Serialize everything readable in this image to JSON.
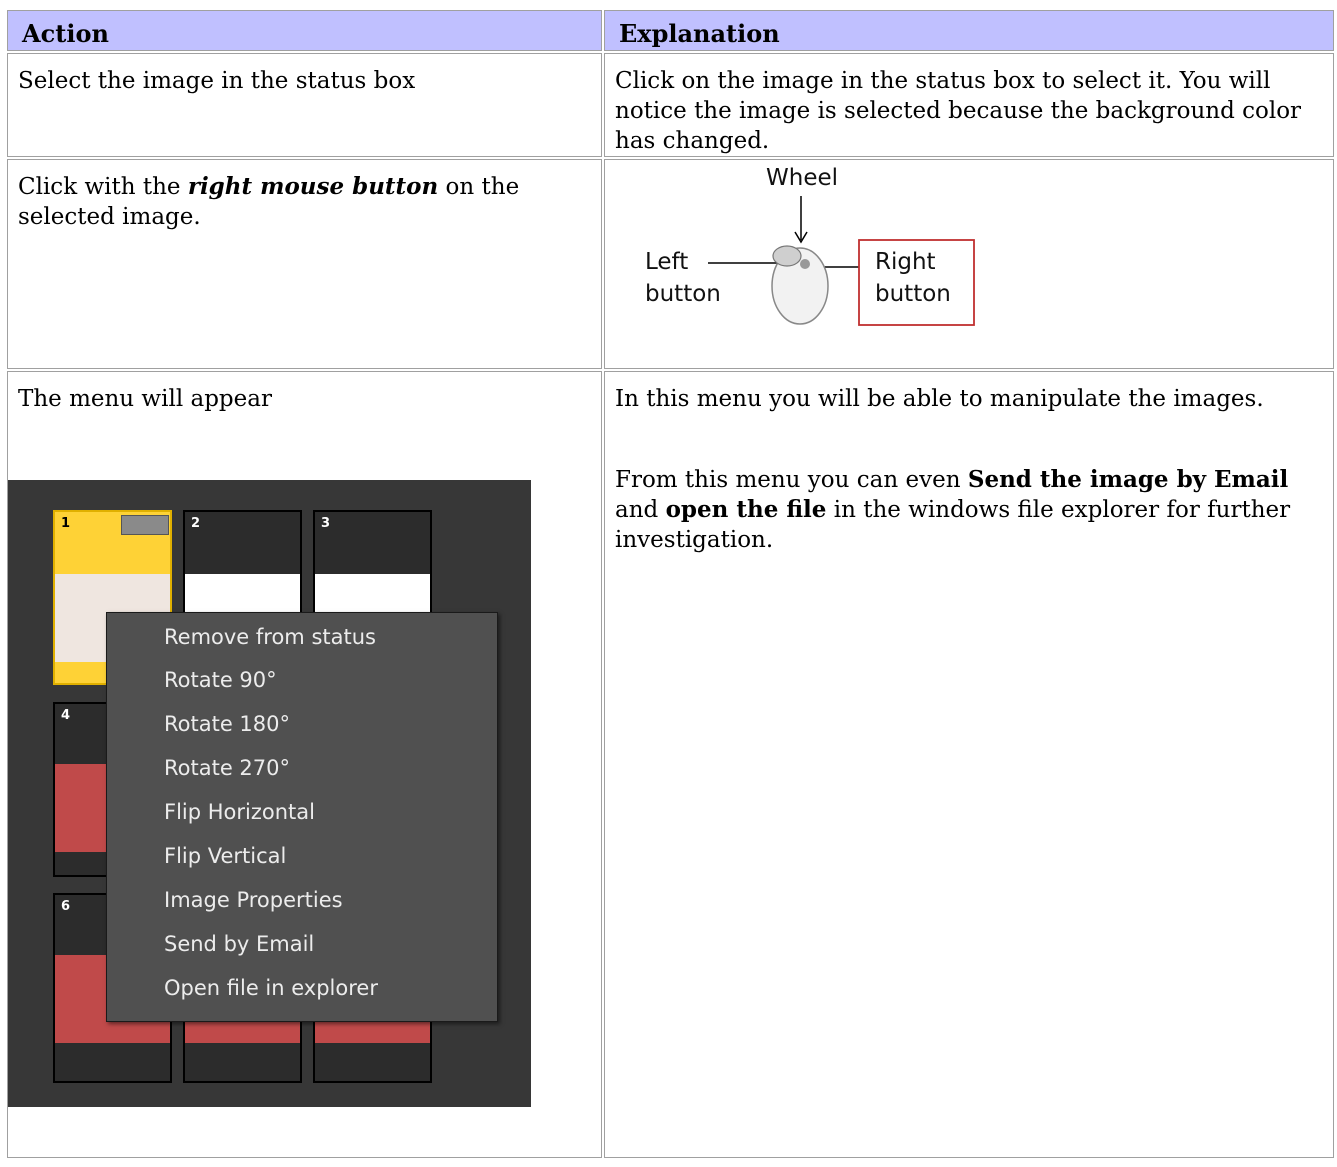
{
  "headers": {
    "action": "Action",
    "explanation": "Explanation"
  },
  "rows": [
    {
      "action": "Select the image in the status box",
      "explanation": "Click on the image in the status box to select it. You will notice the image is selected because the background color has changed."
    },
    {
      "action_pre": "Click with the ",
      "action_em": "right mouse button",
      "action_post": " on the selected image.",
      "diagram": {
        "wheel": "Wheel",
        "left_1": "Left",
        "left_2": "button",
        "right_1": "Right",
        "right_2": "button"
      }
    },
    {
      "action": "The menu will appear",
      "explanation_1": "In this menu you will be able to manipulate the images.",
      "explanation_2_pre": "From this menu you can even ",
      "explanation_2_b1": "Send the image by Email",
      "explanation_2_mid": " and ",
      "explanation_2_b2": "open the file",
      "explanation_2_post": " in the windows file explorer for further investigation.",
      "screenshot": {
        "thumbs": [
          "1",
          "2",
          "3",
          "4",
          "6"
        ],
        "menu": [
          "Remove from status",
          "Rotate 90°",
          "Rotate 180°",
          "Rotate 270°",
          "Flip Horizontal",
          "Flip Vertical",
          "Image Properties",
          "Send by Email",
          "Open file in explorer"
        ]
      }
    }
  ],
  "colors": {
    "header_bg": "#c0c0ff",
    "selected_thumb": "#fed236",
    "menu_bg": "#505050",
    "panel_bg": "#373737"
  }
}
